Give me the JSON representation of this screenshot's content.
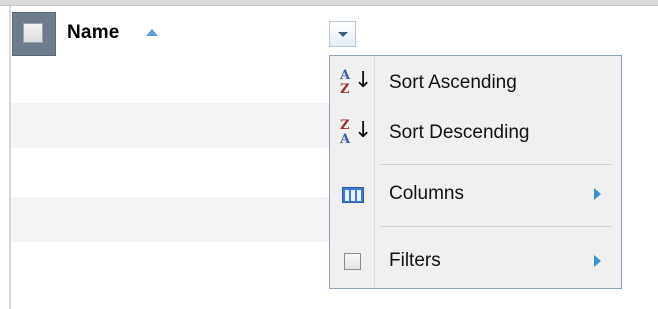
{
  "header": {
    "column_title": "Name",
    "sort_direction_icon": "sort-asc-triangle-icon",
    "select_all_checked": false,
    "menu_trigger_icon": "dropdown-arrow-icon"
  },
  "menu": {
    "items": [
      {
        "label": "Sort Ascending",
        "icon": "sort-ascending-icon",
        "icon_top": "A",
        "icon_bottom": "Z",
        "has_submenu": false
      },
      {
        "label": "Sort Descending",
        "icon": "sort-descending-icon",
        "icon_top": "Z",
        "icon_bottom": "A",
        "has_submenu": false
      },
      {
        "label": "Columns",
        "icon": "columns-icon",
        "has_submenu": true
      },
      {
        "label": "Filters",
        "icon": "filters-checkbox-icon",
        "has_submenu": true
      }
    ]
  },
  "colors": {
    "menu_border": "#8aa2be",
    "submenu_arrow": "#3d8fd6",
    "select_all_bg": "#6f7c8c",
    "sort_arrow": "#5b9bd5"
  }
}
